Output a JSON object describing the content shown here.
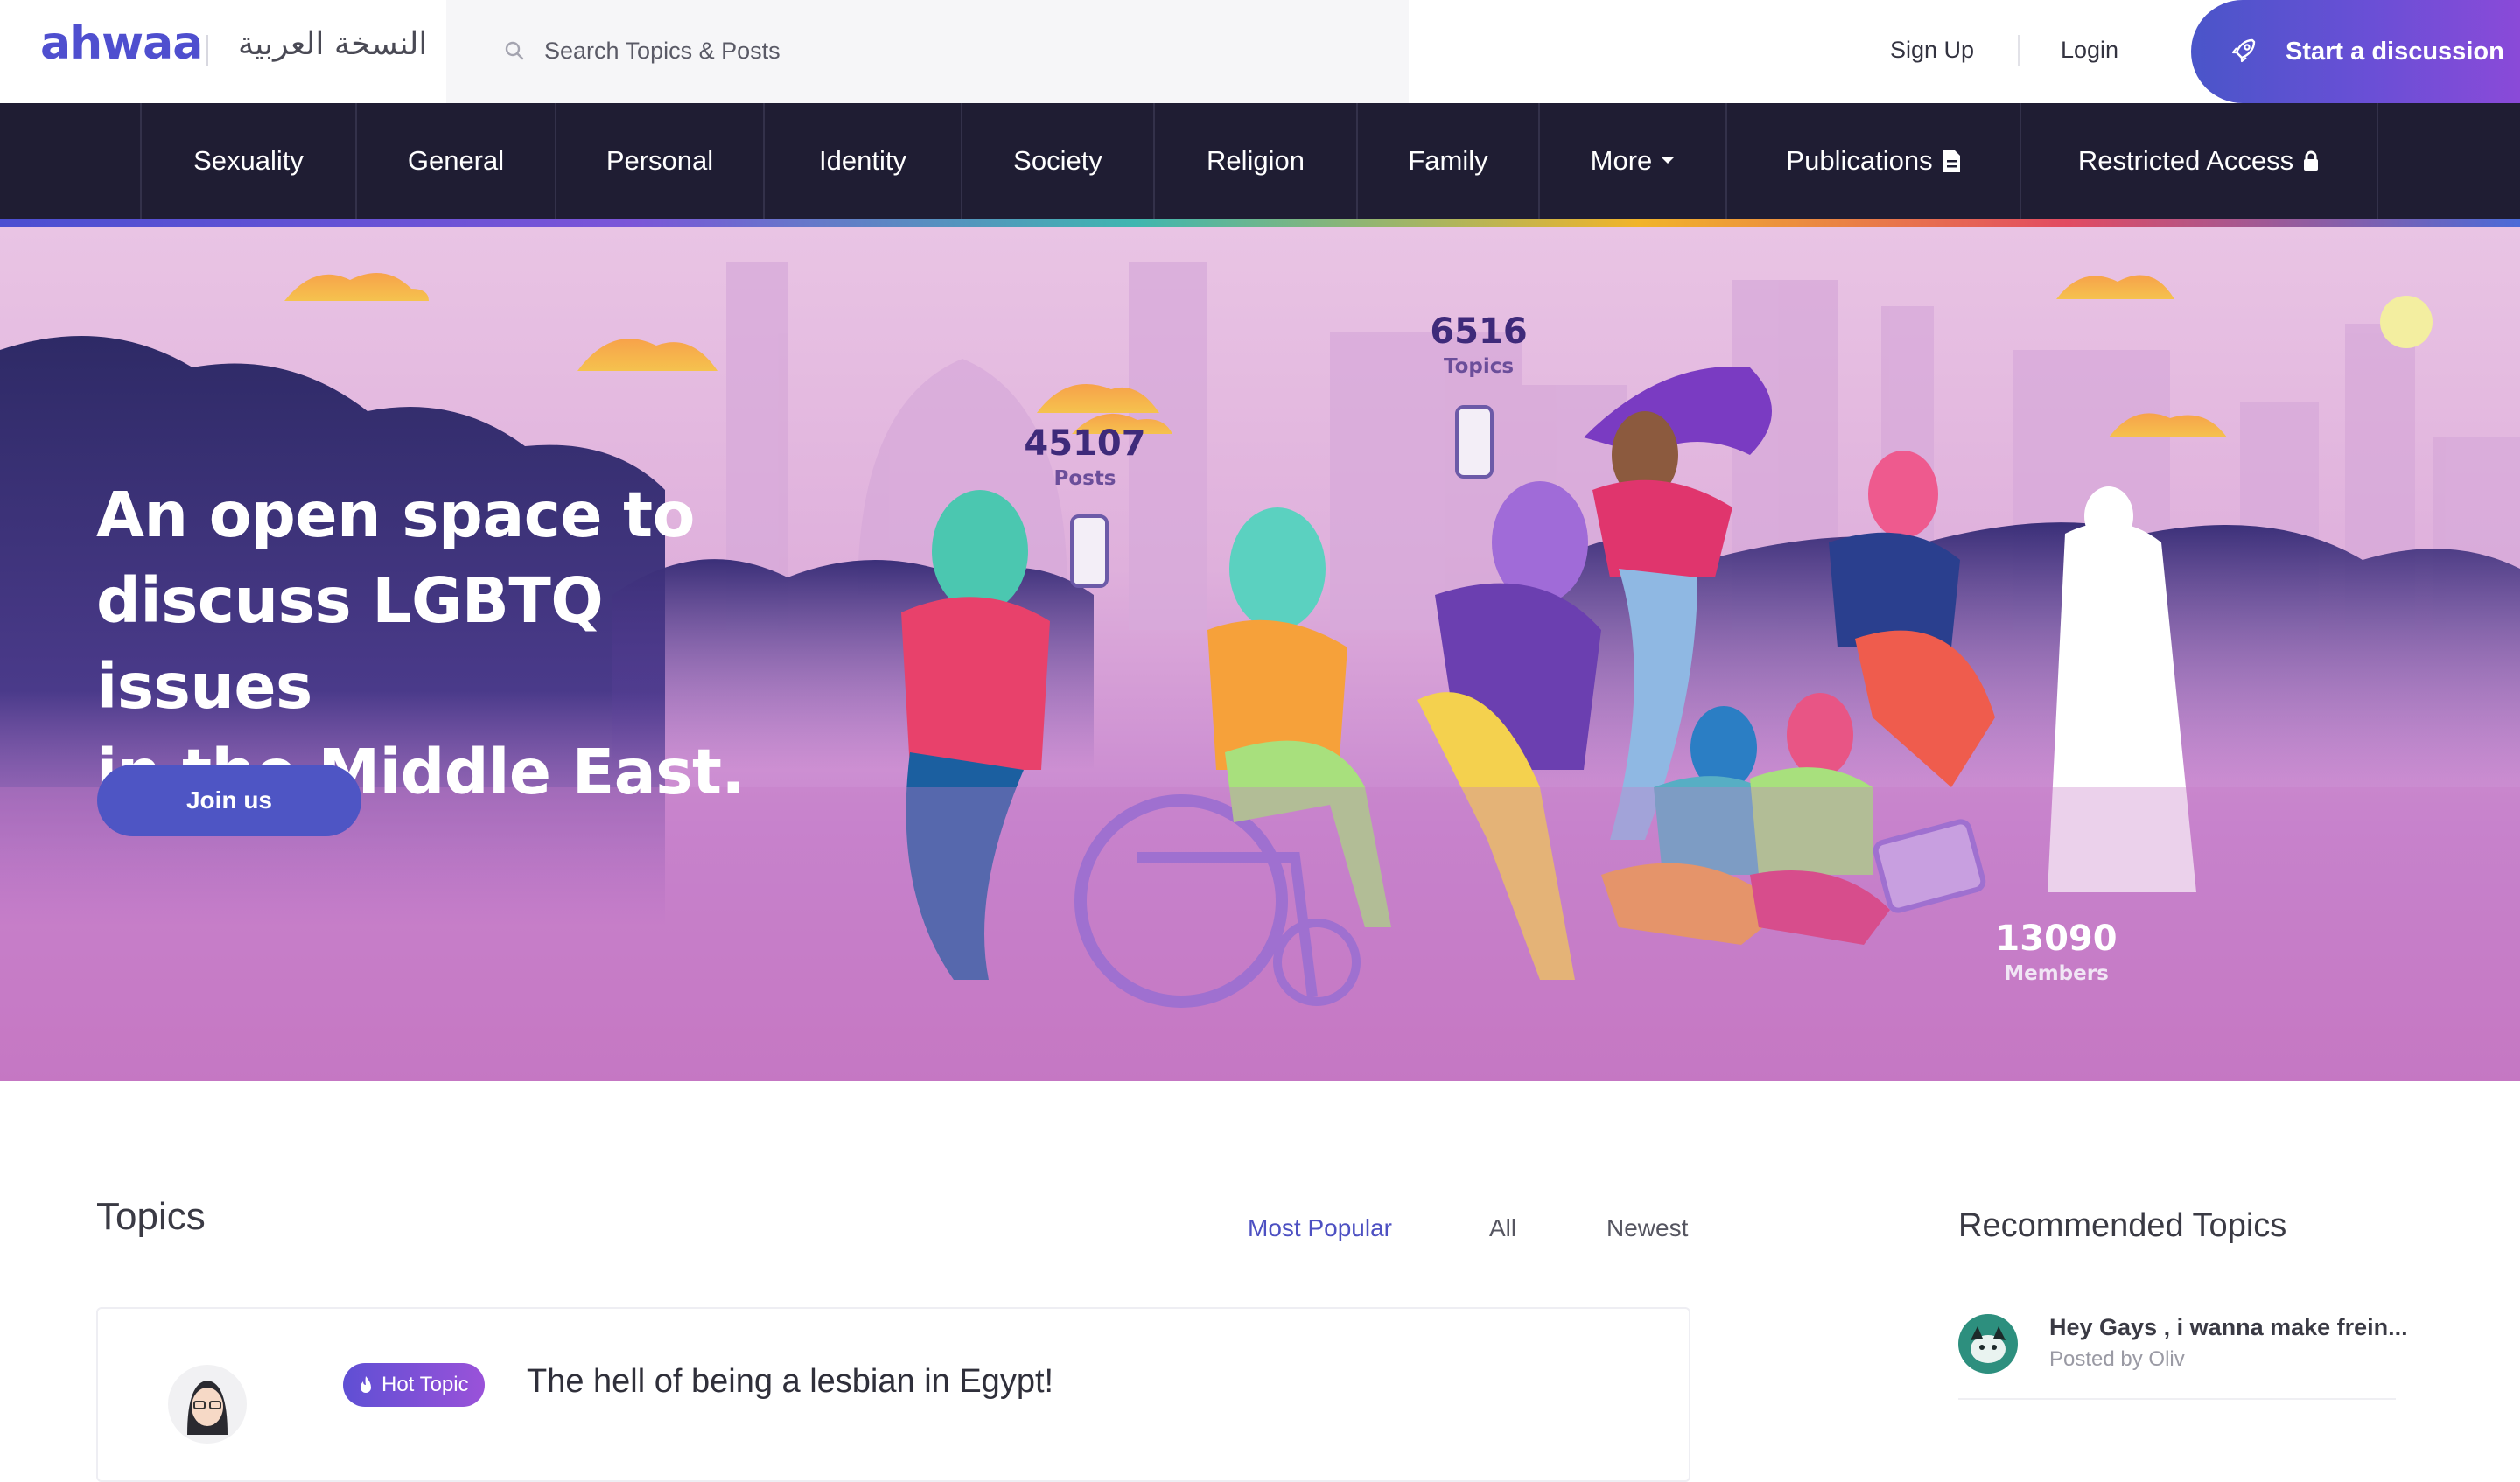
{
  "header": {
    "logo": "ahwaa",
    "arabic_version": "النسخة العربية",
    "search_placeholder": "Search Topics & Posts",
    "sign_up": "Sign Up",
    "login": "Login",
    "start_discussion": "Start a discussion"
  },
  "nav": {
    "items": [
      {
        "label": "Sexuality"
      },
      {
        "label": "General"
      },
      {
        "label": "Personal"
      },
      {
        "label": "Identity"
      },
      {
        "label": "Society"
      },
      {
        "label": "Religion"
      },
      {
        "label": "Family"
      },
      {
        "label": "More",
        "icon": "caret-down-icon"
      },
      {
        "label": "Publications",
        "icon": "document-icon"
      },
      {
        "label": "Restricted Access",
        "icon": "lock-icon"
      }
    ]
  },
  "hero": {
    "title_lines": [
      "An open space to",
      "discuss LGBTQ issues",
      "in the Middle East."
    ],
    "join_label": "Join us",
    "stats": {
      "posts": {
        "value": "45107",
        "label": "Posts"
      },
      "topics": {
        "value": "6516",
        "label": "Topics"
      },
      "members": {
        "value": "13090",
        "label": "Members"
      }
    }
  },
  "topics": {
    "heading": "Topics",
    "tabs": [
      {
        "label": "Most Popular",
        "active": true
      },
      {
        "label": "All",
        "active": false
      },
      {
        "label": "Newest",
        "active": false
      }
    ],
    "items": [
      {
        "badge": "Hot Topic",
        "title": "The hell of being a lesbian in Egypt!"
      }
    ]
  },
  "recommended": {
    "heading": "Recommended Topics",
    "items": [
      {
        "title": "Hey Gays , i wanna make frein...",
        "meta": "Posted by Oliv"
      }
    ]
  },
  "colors": {
    "brand": "#4f4fcf",
    "nav_bg": "#1f1d33",
    "accent": "#4d50c2"
  }
}
